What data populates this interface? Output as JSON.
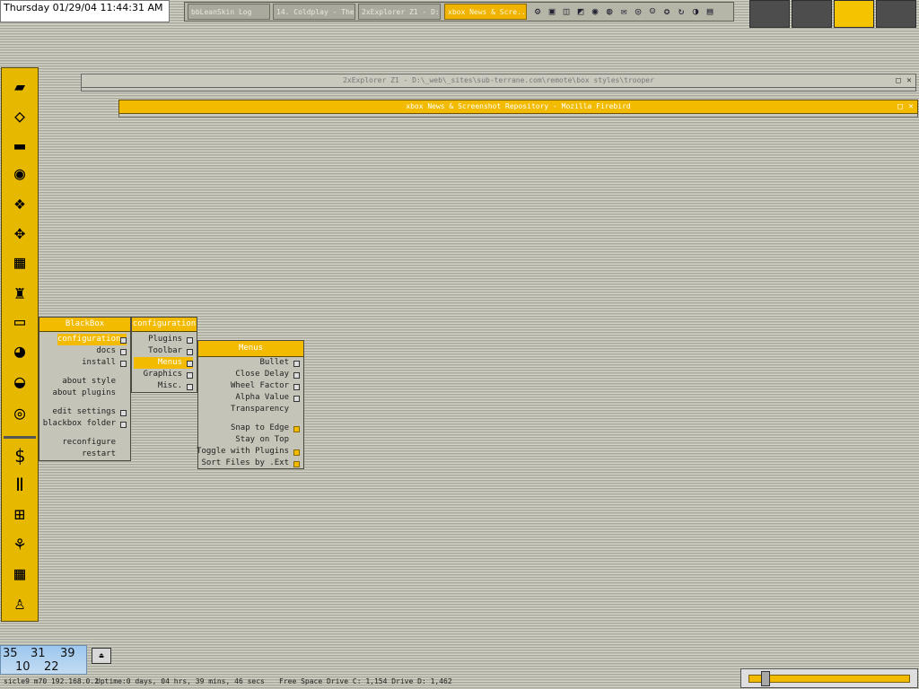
{
  "clock": "Thursday 01/29/04 11:44:31 AM",
  "taskbar": {
    "tasks": [
      {
        "label": "bbLeanSkin Log",
        "active": false
      },
      {
        "label": "14. Coldplay - The...",
        "active": false
      },
      {
        "label": "2xExplorer Z1 - D:...",
        "active": false
      },
      {
        "label": "xbox News & Scre...",
        "active": true
      }
    ]
  },
  "windows": [
    {
      "title": "2xExplorer Z1 - D:\\_web\\_sites\\sub-terrane.com\\remote\\box styles\\trooper",
      "active": false
    },
    {
      "title": "xbox News & Screenshot Repository - Mozilla Firebird",
      "active": true
    }
  ],
  "menus": {
    "root": {
      "title": "BlackBox",
      "items": [
        {
          "label": "configuration",
          "highlight": true,
          "submenu": true
        },
        {
          "label": "docs",
          "submenu": true
        },
        {
          "label": "install",
          "submenu": true
        },
        {
          "label": "about style"
        },
        {
          "label": "about plugins"
        },
        {
          "label": "edit settings",
          "submenu": true
        },
        {
          "label": "blackbox folder",
          "submenu": true
        },
        {
          "label": "reconfigure"
        },
        {
          "label": "restart"
        }
      ]
    },
    "configuration": {
      "title": "configuration",
      "items": [
        {
          "label": "Plugins",
          "submenu": true
        },
        {
          "label": "Toolbar",
          "submenu": true
        },
        {
          "label": "Menus",
          "submenu": true,
          "highlight": true
        },
        {
          "label": "Graphics",
          "submenu": true
        },
        {
          "label": "Misc.",
          "submenu": true
        }
      ]
    },
    "menus": {
      "title": "Menus",
      "items": [
        {
          "label": "Bullet",
          "submenu": true
        },
        {
          "label": "Close Delay",
          "submenu": true
        },
        {
          "label": "Wheel Factor",
          "submenu": true
        },
        {
          "label": "Alpha Value",
          "submenu": true
        },
        {
          "label": "Transparency"
        },
        {
          "label": "Snap to Edge",
          "checked": true
        },
        {
          "label": "Stay on Top"
        },
        {
          "label": "Toggle with Plugins",
          "checked": true
        },
        {
          "label": "Sort Files by .Ext",
          "checked": true
        }
      ]
    }
  },
  "clockwidget": [
    "35",
    "31",
    "39",
    "10",
    "22"
  ],
  "statusbar": {
    "host": "sicle9 m70 192.168.0.2",
    "uptime": "Uptime:0 days, 04 hrs, 39 mins, 46 secs",
    "space": "Free Space Drive C: 1,154 Drive D: 1,462"
  },
  "slider_level": 0.08,
  "colors": {
    "accent": "#f2bb00",
    "menu_bg": "#c4c4b8",
    "workspace_active": "#f4c400"
  }
}
